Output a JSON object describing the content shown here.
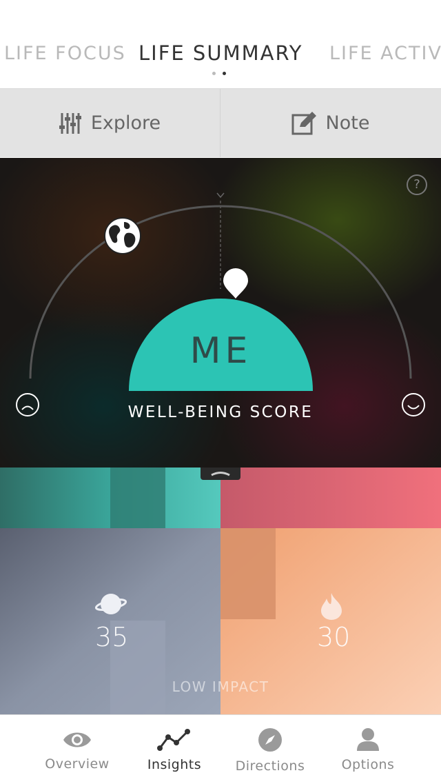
{
  "header": {
    "tabs": [
      {
        "label": "LIFE FOCUS",
        "active": false
      },
      {
        "label": "LIFE SUMMARY",
        "active": true
      },
      {
        "label": "LIFE ACTIVIT",
        "active": false
      }
    ],
    "page_dots": [
      false,
      true
    ]
  },
  "toolbar": {
    "explore_label": "Explore",
    "note_label": "Note"
  },
  "score_panel": {
    "help_icon": "?",
    "center_label": "ME",
    "score_title": "WELL-BEING SCORE",
    "left_icon": "sad-face-icon",
    "right_icon": "happy-face-icon",
    "marker_icon": "globe-icon",
    "accent_color": "#2cc4b4"
  },
  "tiles": {
    "left_score": "35",
    "right_score": "30",
    "impact_label": "LOW IMPACT",
    "left_icon": "planet-icon",
    "right_icon": "flame-icon"
  },
  "tabbar": {
    "items": [
      {
        "label": "Overview",
        "icon": "eye-icon",
        "active": false
      },
      {
        "label": "Insights",
        "icon": "insights-graph-icon",
        "active": true
      },
      {
        "label": "Directions",
        "icon": "compass-icon",
        "active": false
      },
      {
        "label": "Options",
        "icon": "person-icon",
        "active": false
      }
    ]
  }
}
